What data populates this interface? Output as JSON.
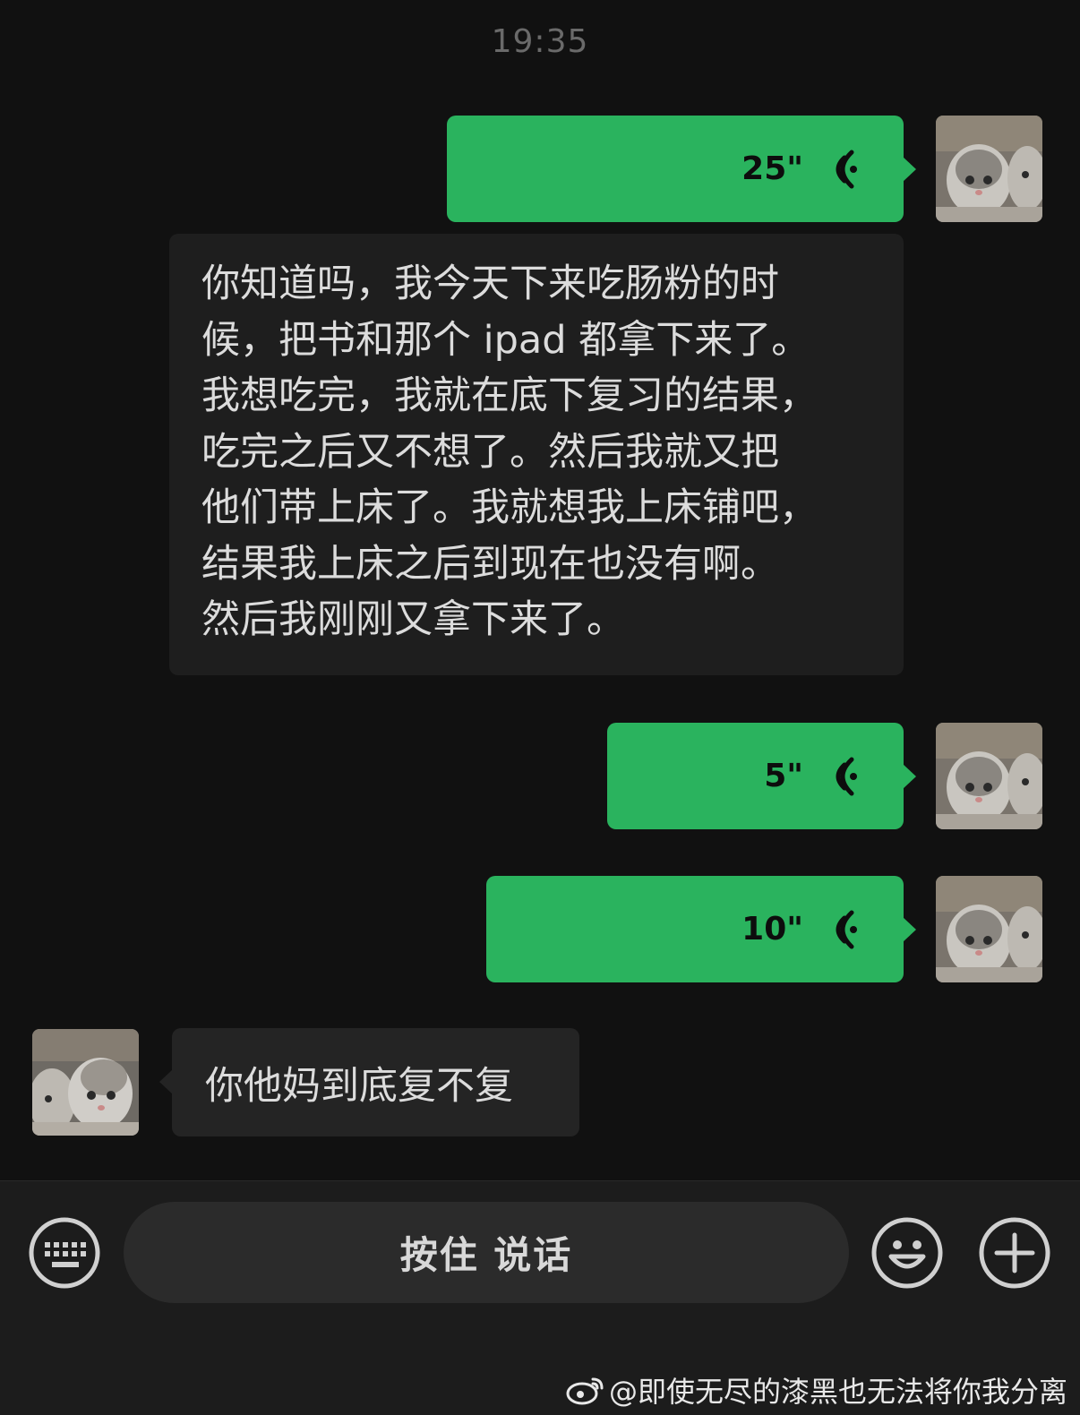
{
  "status": {
    "time": "19:35"
  },
  "messages": [
    {
      "type": "voice",
      "direction": "outgoing",
      "duration": "25\"",
      "avatar_icon": "kitten-avatar-icon"
    },
    {
      "type": "transcript",
      "lines": [
        "你知道吗，我今天下来吃肠粉的时",
        "候，把书和那个 ipad 都拿下来了。",
        "我想吃完，我就在底下复习的结果，",
        "吃完之后又不想了。然后我就又把",
        "他们带上床了。我就想我上床铺吧，",
        "结果我上床之后到现在也没有啊。",
        "然后我刚刚又拿下来了。"
      ]
    },
    {
      "type": "voice",
      "direction": "outgoing",
      "duration": "5\"",
      "avatar_icon": "kitten-avatar-icon"
    },
    {
      "type": "voice",
      "direction": "outgoing",
      "duration": "10\"",
      "avatar_icon": "kitten-avatar-icon"
    },
    {
      "type": "text",
      "direction": "incoming",
      "text": "你他妈到底复不复",
      "avatar_icon": "kitten-avatar-icon"
    }
  ],
  "input_bar": {
    "hold_to_talk_label": "按住 说话",
    "left_icon": "keyboard-icon",
    "right_icons": [
      "emoji-icon",
      "plus-icon"
    ]
  },
  "watermark": {
    "text": "@即使无尽的漆黑也无法将你我分离",
    "icon": "weibo-icon"
  },
  "colors": {
    "background": "#111111",
    "outgoing_bubble": "#2ab35e",
    "incoming_bubble": "#242424"
  }
}
